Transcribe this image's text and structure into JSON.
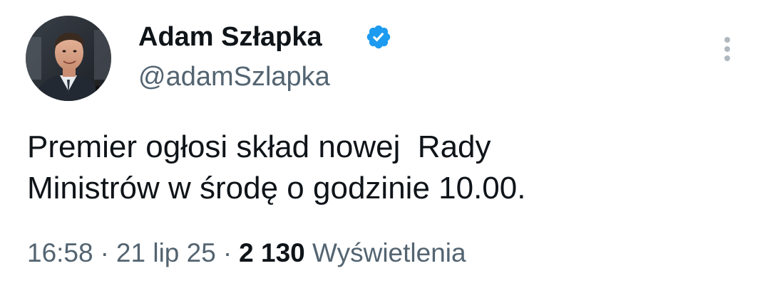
{
  "author": {
    "name": "Adam Szłapka",
    "handle": "@adamSzlapka",
    "verified_color": "#1d9bf0"
  },
  "tweet": {
    "lines": [
      "Premier ogłosi skład nowej  Rady",
      "Ministrów w środę o godzinie 10.00."
    ]
  },
  "meta": {
    "time": "16:58",
    "separator": "·",
    "date": "21 lip 25",
    "views_count": "2 130",
    "views_label": "Wyświetlenia"
  },
  "icons": {
    "verified": "verified-badge-icon",
    "more": "more-vertical-icon"
  },
  "colors": {
    "text": "#0f1419",
    "secondary": "#536471",
    "accent": "#1d9bf0"
  }
}
